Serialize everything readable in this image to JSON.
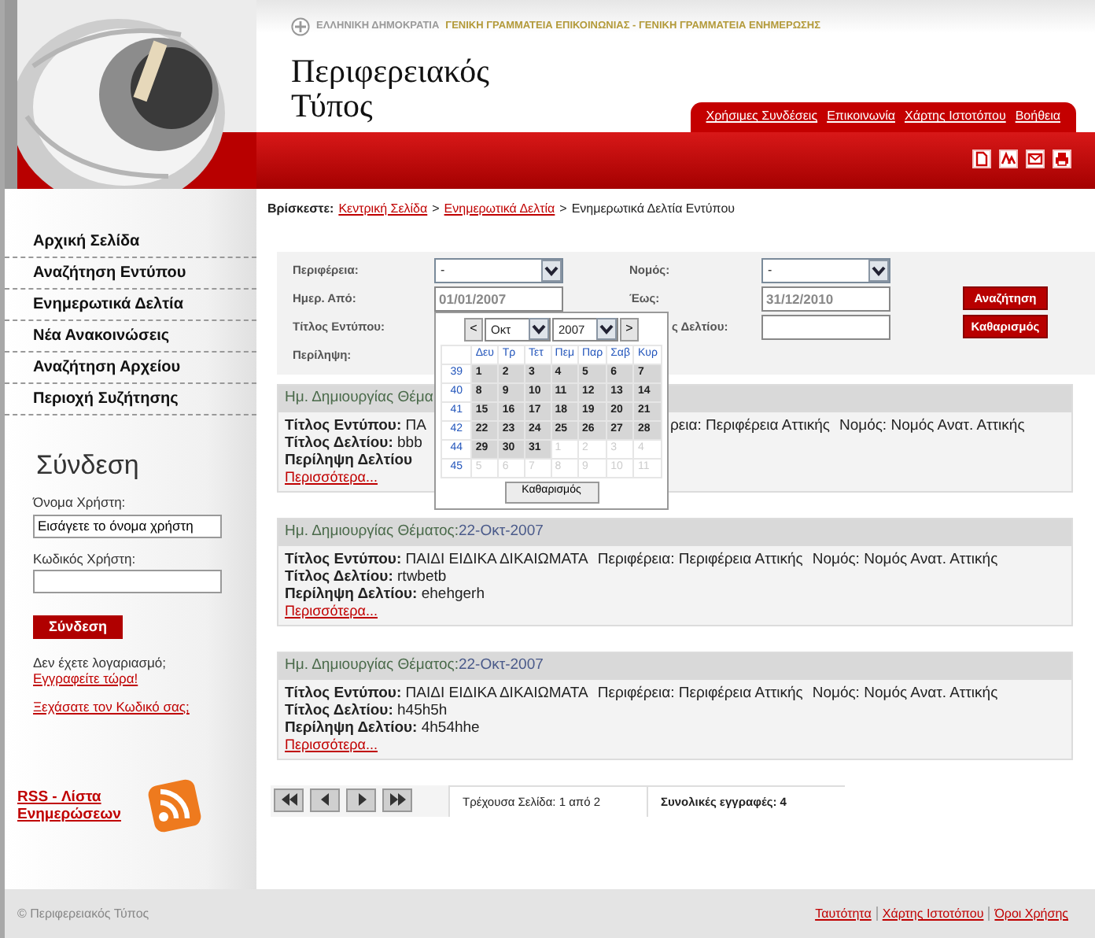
{
  "header": {
    "gov_label": "ΕΛΛΗΝΙΚΗ ΔΗΜΟΚΡΑΤΙΑ",
    "gov_units": "ΓΕΝΙΚΗ ΓΡΑΜΜΑΤΕΙΑ ΕΠΙΚΟΙΝΩΝΙΑΣ - ΓΕΝΙΚΗ ΓΡΑΜΜΑΤΕΙΑ ΕΝΗΜΕΡΩΣΗΣ",
    "site_title": "Περιφερειακός Τύπος",
    "links": [
      "Χρήσιμες Συνδέσεις",
      "Επικοινωνία",
      "Χάρτης Ιστοτόπου",
      "Βοήθεια"
    ]
  },
  "sidebar": {
    "menu": [
      "Αρχική Σελίδα",
      "Αναζήτηση Εντύπου",
      "Ενημερωτικά Δελτία",
      "Νέα Ανακοινώσεις",
      "Αναζήτηση Αρχείου",
      "Περιοχή Συζήτησης"
    ],
    "login": {
      "title": "Σύνδεση",
      "username_label": "Όνομα Χρήστη:",
      "username_value": "Εισάγετε το όνομα χρήστη",
      "password_label": "Κωδικός Χρήστη:",
      "submit": "Σύνδεση",
      "no_account": "Δεν έχετε λογαριασμό;",
      "register": "Εγγραφείτε τώρα!",
      "forgot": "Ξεχάσατε τον Κωδικό σας;"
    },
    "rss_link": "RSS - Λίστα Ενημερώσεων"
  },
  "breadcrumb": {
    "label": "Βρίσκεστε:",
    "items": [
      {
        "text": "Κεντρική Σελίδα",
        "kind": "link"
      },
      {
        "text": ">",
        "kind": "separator"
      },
      {
        "text": "Ενημερωτικά Δελτία",
        "kind": "link"
      },
      {
        "text": ">",
        "kind": "separator"
      },
      {
        "text": "Ενημερωτικά Δελτία Εντύπου",
        "kind": "text"
      }
    ]
  },
  "filters": {
    "region_label": "Περιφέρεια:",
    "region_value": "-",
    "prefecture_label": "Νομός:",
    "prefecture_value": "-",
    "date_from_label": "Ημερ. Από:",
    "date_from_value": "01/01/2007",
    "date_to_label": "Έως:",
    "date_to_value": "31/12/2010",
    "print_title_label": "Τίτλος Εντύπου:",
    "bulletin_title_label": "ς Δελτίου:",
    "summary_label": "Περίληψη:",
    "search_button": "Αναζήτηση",
    "clear_button": "Καθαρισμός"
  },
  "calendar": {
    "prev": "<",
    "month": "Οκτ",
    "year": "2007",
    "next": ">",
    "weekdays": [
      "Δευ",
      "Τρ",
      "Τετ",
      "Πεμ",
      "Παρ",
      "Σαβ",
      "Κυρ"
    ],
    "weeks": [
      {
        "number": "39",
        "days": [
          {
            "day": "1",
            "muted": false
          },
          {
            "day": "2",
            "muted": false
          },
          {
            "day": "3",
            "muted": false
          },
          {
            "day": "4",
            "muted": false
          },
          {
            "day": "5",
            "muted": false
          },
          {
            "day": "6",
            "muted": false
          },
          {
            "day": "7",
            "muted": false
          }
        ]
      },
      {
        "number": "40",
        "days": [
          {
            "day": "8",
            "muted": false
          },
          {
            "day": "9",
            "muted": false
          },
          {
            "day": "10",
            "muted": false
          },
          {
            "day": "11",
            "muted": false
          },
          {
            "day": "12",
            "muted": false
          },
          {
            "day": "13",
            "muted": false
          },
          {
            "day": "14",
            "muted": false
          }
        ]
      },
      {
        "number": "41",
        "days": [
          {
            "day": "15",
            "muted": false
          },
          {
            "day": "16",
            "muted": false
          },
          {
            "day": "17",
            "muted": false
          },
          {
            "day": "18",
            "muted": false
          },
          {
            "day": "19",
            "muted": false
          },
          {
            "day": "20",
            "muted": false
          },
          {
            "day": "21",
            "muted": false
          }
        ]
      },
      {
        "number": "42",
        "days": [
          {
            "day": "22",
            "muted": false
          },
          {
            "day": "23",
            "muted": false
          },
          {
            "day": "24",
            "muted": false
          },
          {
            "day": "25",
            "muted": false
          },
          {
            "day": "26",
            "muted": false
          },
          {
            "day": "27",
            "muted": false
          },
          {
            "day": "28",
            "muted": false
          }
        ]
      },
      {
        "number": "44",
        "days": [
          {
            "day": "29",
            "muted": false
          },
          {
            "day": "30",
            "muted": false
          },
          {
            "day": "31",
            "muted": false
          },
          {
            "day": "1",
            "muted": true
          },
          {
            "day": "2",
            "muted": true
          },
          {
            "day": "3",
            "muted": true
          },
          {
            "day": "4",
            "muted": true
          }
        ]
      },
      {
        "number": "45",
        "days": [
          {
            "day": "5",
            "muted": true
          },
          {
            "day": "6",
            "muted": true
          },
          {
            "day": "7",
            "muted": true
          },
          {
            "day": "8",
            "muted": true
          },
          {
            "day": "9",
            "muted": true
          },
          {
            "day": "10",
            "muted": true
          },
          {
            "day": "11",
            "muted": true
          }
        ]
      }
    ],
    "clear": "Καθαρισμός"
  },
  "results": [
    {
      "kind": "partial",
      "date_label": "Ημ. Δημιουργίας Θέμα",
      "print_title_label": "Τίτλος Εντύπου:",
      "print_title": "ΠΑ",
      "region": "ρεια: Περιφέρεια Αττικής",
      "prefecture": "Νομός: Νομός Ανατ. Αττικής",
      "bulletin_label": "Τίτλος Δελτίου:",
      "bulletin": "bbb",
      "summary_label": "Περίληψη Δελτίου",
      "more": "Περισσότερα..."
    },
    {
      "kind": "full",
      "date_label": "Ημ. Δημιουργίας Θέματος:",
      "date": "22-Οκτ-2007",
      "print_title_label": "Τίτλος Εντύπου:",
      "print_title": "ΠΑΙΔΙ ΕΙΔΙΚΑ ΔΙΚΑΙΩΜΑΤΑ",
      "region": "Περιφέρεια: Περιφέρεια Αττικής",
      "prefecture": "Νομός: Νομός Ανατ. Αττικής",
      "bulletin_label": "Τίτλος Δελτίου:",
      "bulletin": "rtwbetb",
      "summary_label": "Περίληψη Δελτίου:",
      "summary": "ehehgerh",
      "more": "Περισσότερα..."
    },
    {
      "kind": "full",
      "date_label": "Ημ. Δημιουργίας Θέματος:",
      "date": "22-Οκτ-2007",
      "print_title_label": "Τίτλος Εντύπου:",
      "print_title": "ΠΑΙΔΙ ΕΙΔΙΚΑ ΔΙΚΑΙΩΜΑΤΑ",
      "region": "Περιφέρεια: Περιφέρεια Αττικής",
      "prefecture": "Νομός: Νομός Ανατ. Αττικής",
      "bulletin_label": "Τίτλος Δελτίου:",
      "bulletin": "h45h5h",
      "summary_label": "Περίληψη Δελτίου:",
      "summary": "4h54hhe",
      "more": "Περισσότερα..."
    }
  ],
  "pagination": {
    "page_label": "Τρέχουσα Σελίδα: 1 από 2",
    "total_label": "Συνολικές εγγραφές:",
    "total": "4"
  },
  "footer": {
    "copyright": "© Περιφερειακός Τύπος",
    "links": [
      "Ταυτότητα",
      "Χάρτης Ιστοτόπου",
      "Όροι Χρήσης"
    ]
  }
}
